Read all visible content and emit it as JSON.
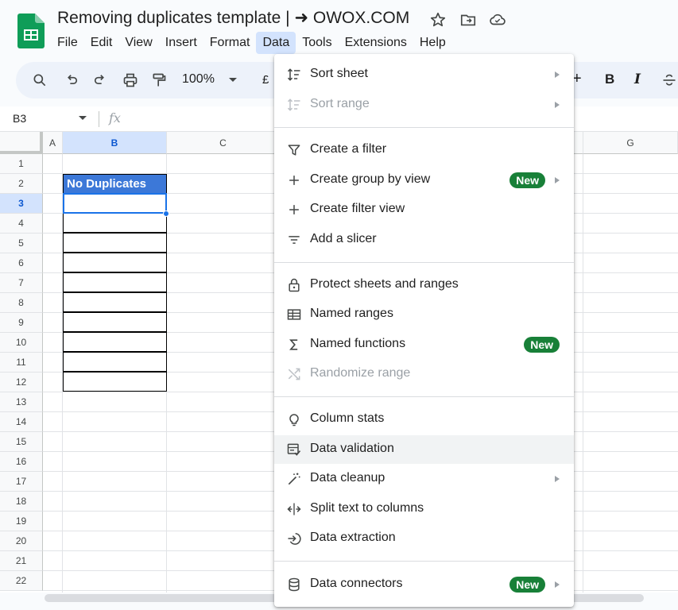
{
  "doc": {
    "title": "Removing duplicates template | ➜ OWOX.COM"
  },
  "menubar": [
    "File",
    "Edit",
    "View",
    "Insert",
    "Format",
    "Data",
    "Tools",
    "Extensions",
    "Help"
  ],
  "active_menu": "Data",
  "toolbar": {
    "zoom": "100%",
    "currency": "£",
    "plus": "+",
    "bold": "B",
    "italic": "I"
  },
  "namebox": "B3",
  "fx": "fx",
  "columns": [
    "A",
    "B",
    "C",
    "G"
  ],
  "rows": [
    "1",
    "2",
    "3",
    "4",
    "5",
    "6",
    "7",
    "8",
    "9",
    "10",
    "11",
    "12",
    "13",
    "14",
    "15",
    "16",
    "17",
    "18",
    "19",
    "20",
    "21",
    "22"
  ],
  "cells": {
    "B2": "No Duplicates"
  },
  "data_menu": {
    "sort_sheet": "Sort sheet",
    "sort_range": "Sort range",
    "create_filter": "Create a filter",
    "create_group_by_view": "Create group by view",
    "create_filter_view": "Create filter view",
    "add_slicer": "Add a slicer",
    "protect": "Protect sheets and ranges",
    "named_ranges": "Named ranges",
    "named_functions": "Named functions",
    "randomize_range": "Randomize range",
    "column_stats": "Column stats",
    "data_validation": "Data validation",
    "data_cleanup": "Data cleanup",
    "split_text": "Split text to columns",
    "data_extraction": "Data extraction",
    "data_connectors": "Data connectors",
    "badge_new": "New"
  },
  "colors": {
    "accent": "#1a73e8",
    "header_fill": "#3c78d8",
    "badge": "#188038",
    "menu_active": "#d3e3fd"
  }
}
